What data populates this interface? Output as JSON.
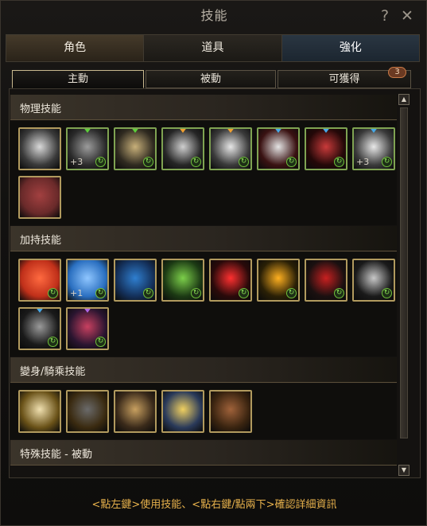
{
  "window": {
    "title": "技能"
  },
  "main_tabs": [
    {
      "label": "角色",
      "active": false
    },
    {
      "label": "道具",
      "active": false
    },
    {
      "label": "強化",
      "active": true
    }
  ],
  "sub_tabs": [
    {
      "label": "主動",
      "active": true
    },
    {
      "label": "被動",
      "active": false
    },
    {
      "label": "可獲得",
      "active": false
    }
  ],
  "obtainable_badge": "3",
  "sections": [
    {
      "title": "物理技能",
      "icon_count": 9,
      "icons": [
        {
          "name": "skill-icon",
          "level": "",
          "gem": "none",
          "cd": false
        },
        {
          "name": "skill-icon",
          "level": "+3",
          "gem": "g",
          "cd": true
        },
        {
          "name": "skill-icon",
          "level": "",
          "gem": "g",
          "cd": true
        },
        {
          "name": "skill-icon",
          "level": "",
          "gem": "o",
          "cd": true
        },
        {
          "name": "skill-icon",
          "level": "",
          "gem": "o",
          "cd": true
        },
        {
          "name": "skill-icon",
          "level": "",
          "gem": "b",
          "cd": true
        },
        {
          "name": "skill-icon",
          "level": "",
          "gem": "b",
          "cd": true
        },
        {
          "name": "skill-icon",
          "level": "+3",
          "gem": "b",
          "cd": true
        },
        {
          "name": "skill-icon",
          "level": "",
          "gem": "none",
          "cd": false
        }
      ]
    },
    {
      "title": "加持技能",
      "icon_count": 10,
      "icons": [
        {
          "name": "skill-icon",
          "level": "",
          "gem": "none",
          "cd": true
        },
        {
          "name": "skill-icon",
          "level": "+1",
          "gem": "none",
          "cd": true
        },
        {
          "name": "skill-icon",
          "level": "",
          "gem": "none",
          "cd": true
        },
        {
          "name": "skill-icon",
          "level": "",
          "gem": "none",
          "cd": true
        },
        {
          "name": "skill-icon",
          "level": "",
          "gem": "none",
          "cd": true
        },
        {
          "name": "skill-icon",
          "level": "",
          "gem": "none",
          "cd": true
        },
        {
          "name": "skill-icon",
          "level": "",
          "gem": "none",
          "cd": true
        },
        {
          "name": "skill-icon",
          "level": "",
          "gem": "none",
          "cd": true
        },
        {
          "name": "skill-icon",
          "level": "",
          "gem": "b",
          "cd": true
        },
        {
          "name": "skill-icon",
          "level": "",
          "gem": "p",
          "cd": true
        }
      ]
    },
    {
      "title": "變身/騎乘技能",
      "icon_count": 5,
      "icons": [
        {
          "name": "skill-icon",
          "level": "",
          "gem": "none",
          "cd": false
        },
        {
          "name": "skill-icon",
          "level": "",
          "gem": "none",
          "cd": false
        },
        {
          "name": "skill-icon",
          "level": "",
          "gem": "none",
          "cd": false
        },
        {
          "name": "skill-icon",
          "level": "",
          "gem": "none",
          "cd": false
        },
        {
          "name": "skill-icon",
          "level": "",
          "gem": "none",
          "cd": false
        }
      ]
    },
    {
      "title": "特殊技能 - 被動",
      "icon_count": 0,
      "icons": []
    }
  ],
  "footer": "<點左鍵>使用技能、<點右鍵/點兩下>確認詳細資訊",
  "colors": {
    "accent": "#e8b24c",
    "active_tab": "#1c2630",
    "frame": "#b19a5e"
  }
}
